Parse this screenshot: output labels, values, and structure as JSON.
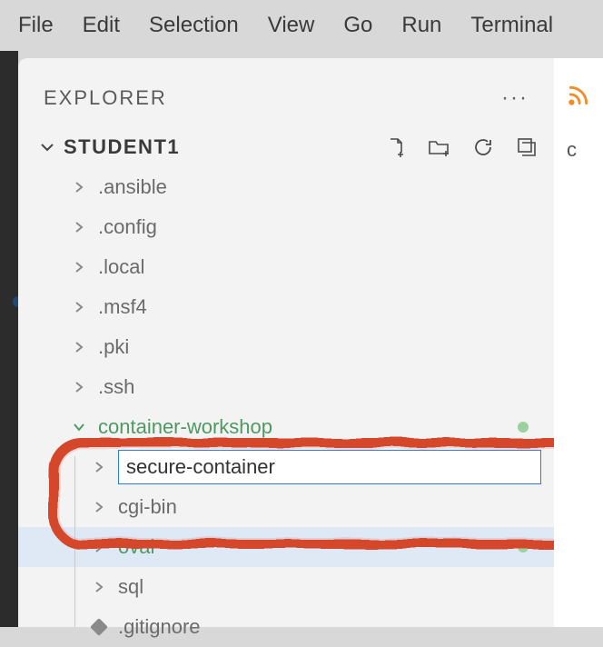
{
  "menubar": {
    "file": "File",
    "edit": "Edit",
    "selection": "Selection",
    "view": "View",
    "go": "Go",
    "run": "Run",
    "terminal": "Terminal"
  },
  "explorer": {
    "title": "EXPLORER",
    "more": "···",
    "section": "STUDENT1"
  },
  "tree": {
    "items": [
      {
        "label": ".ansible"
      },
      {
        "label": ".config"
      },
      {
        "label": ".local"
      },
      {
        "label": ".msf4"
      },
      {
        "label": ".pki"
      },
      {
        "label": ".ssh"
      }
    ],
    "expanded": {
      "label": "container-workshop"
    },
    "editing_value": "secure-container",
    "children": [
      {
        "label": "cgi-bin"
      },
      {
        "label": "oval"
      },
      {
        "label": "sql"
      },
      {
        "label": ".gitignore"
      }
    ]
  },
  "right": {
    "letter": "c"
  },
  "colors": {
    "accent": "#2a7be4",
    "modified": "#4e9a62",
    "scribble": "#d5462a"
  }
}
